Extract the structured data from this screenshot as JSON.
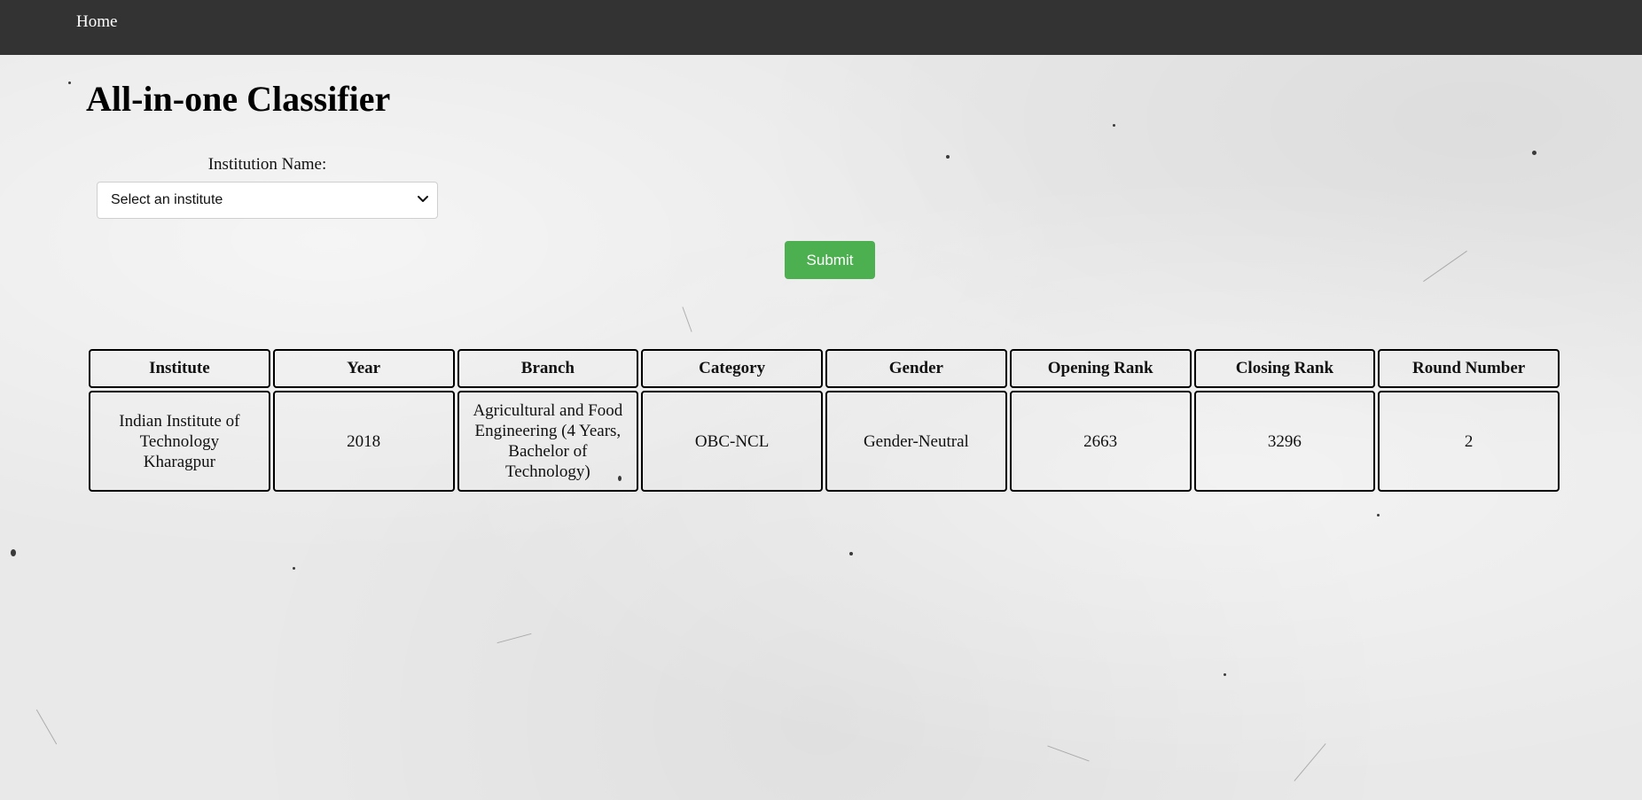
{
  "navbar": {
    "home_label": "Home"
  },
  "page": {
    "title": "All-in-one Classifier"
  },
  "form": {
    "institution_label": "Institution Name:",
    "institution_select_value": "Select an institute",
    "submit_label": "Submit"
  },
  "results_table": {
    "headers": [
      "Institute",
      "Year",
      "Branch",
      "Category",
      "Gender",
      "Opening Rank",
      "Closing Rank",
      "Round Number"
    ],
    "rows": [
      [
        "Indian Institute of Technology Kharagpur",
        "2018",
        "Agricultural and Food Engineering (4 Years, Bachelor of Technology)",
        "OBC-NCL",
        "Gender-Neutral",
        "2663",
        "3296",
        "2"
      ]
    ]
  },
  "colors": {
    "navbar_bg": "#333333",
    "submit_bg": "#4caf50",
    "page_bg": "#e9e9e9"
  },
  "icons": {
    "select_arrow": "chevron-down-icon"
  }
}
